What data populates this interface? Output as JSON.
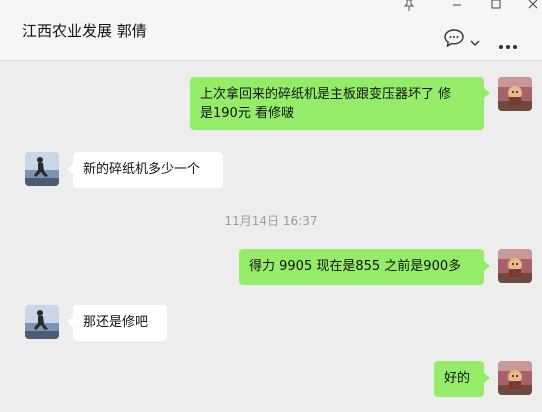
{
  "window": {
    "title": "江西农业发展 郭倩"
  },
  "timestamp": "11月14日 16:37",
  "messages": [
    {
      "direction": "sent",
      "text": "上次拿回来的碎纸机是主板跟变压器坏了 修\n是190元 看修啵"
    },
    {
      "direction": "received",
      "text": "新的碎纸机多少一个"
    },
    {
      "direction": "sent",
      "text": "得力 9905 现在是855 之前是900多"
    },
    {
      "direction": "received",
      "text": "那还是修吧"
    },
    {
      "direction": "sent",
      "text": "好的"
    }
  ],
  "icons": {
    "pin": "pin-icon",
    "minimize": "minimize-icon",
    "maximize": "maximize-icon",
    "close": "close-icon",
    "chat": "chat-bubble-icon",
    "dropdown": "chevron-down-icon",
    "more": "more-icon"
  },
  "colors": {
    "sent_bubble": "#95ec69",
    "received_bubble": "#ffffff",
    "background": "#ededed",
    "header": "#f5f5f5"
  }
}
